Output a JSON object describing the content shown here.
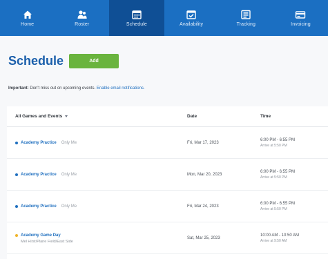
{
  "nav": {
    "items": [
      {
        "label": "Home",
        "icon": "home-icon"
      },
      {
        "label": "Roster",
        "icon": "roster-icon"
      },
      {
        "label": "Schedule",
        "icon": "calendar-icon",
        "active": true
      },
      {
        "label": "Availability",
        "icon": "availability-icon"
      },
      {
        "label": "Tracking",
        "icon": "tracking-icon"
      },
      {
        "label": "Invoicing",
        "icon": "invoicing-icon"
      }
    ],
    "bar_color": "#1b6fc2",
    "active_color": "#0f4f95"
  },
  "header": {
    "title": "Schedule",
    "add_label": "Add",
    "add_color": "#6ab43e"
  },
  "notice": {
    "strong": "Important:",
    "text": " Don't miss out on upcoming events. ",
    "link": "Enable email notifications."
  },
  "table": {
    "headers": {
      "events": "All Games and Events",
      "date": "Date",
      "time": "Time"
    },
    "rows": [
      {
        "name": "Academy Practice",
        "tag": "Only Me",
        "sub": "",
        "date": "Fri, Mar 17, 2023",
        "time": "6:00 PM - 6:55 PM",
        "arrive": "Arrive at 5:50 PM",
        "dot": "#1f6fbf"
      },
      {
        "name": "Academy Practice",
        "tag": "Only Me",
        "sub": "",
        "date": "Mon, Mar 20, 2023",
        "time": "6:00 PM - 6:55 PM",
        "arrive": "Arrive at 5:50 PM",
        "dot": "#1f6fbf"
      },
      {
        "name": "Academy Practice",
        "tag": "Only Me",
        "sub": "",
        "date": "Fri, Mar 24, 2023",
        "time": "6:00 PM - 6:55 PM",
        "arrive": "Arrive at 5:50 PM",
        "dot": "#1f6fbf"
      },
      {
        "name": "Academy Game Day",
        "tag": "",
        "sub": "Mel Hirst/Plane Field/East Side",
        "date": "Sat, Mar 25, 2023",
        "time": "10:00 AM - 10:50 AM",
        "arrive": "Arrive at 9:50 AM",
        "dot": "#f0b429"
      }
    ]
  }
}
